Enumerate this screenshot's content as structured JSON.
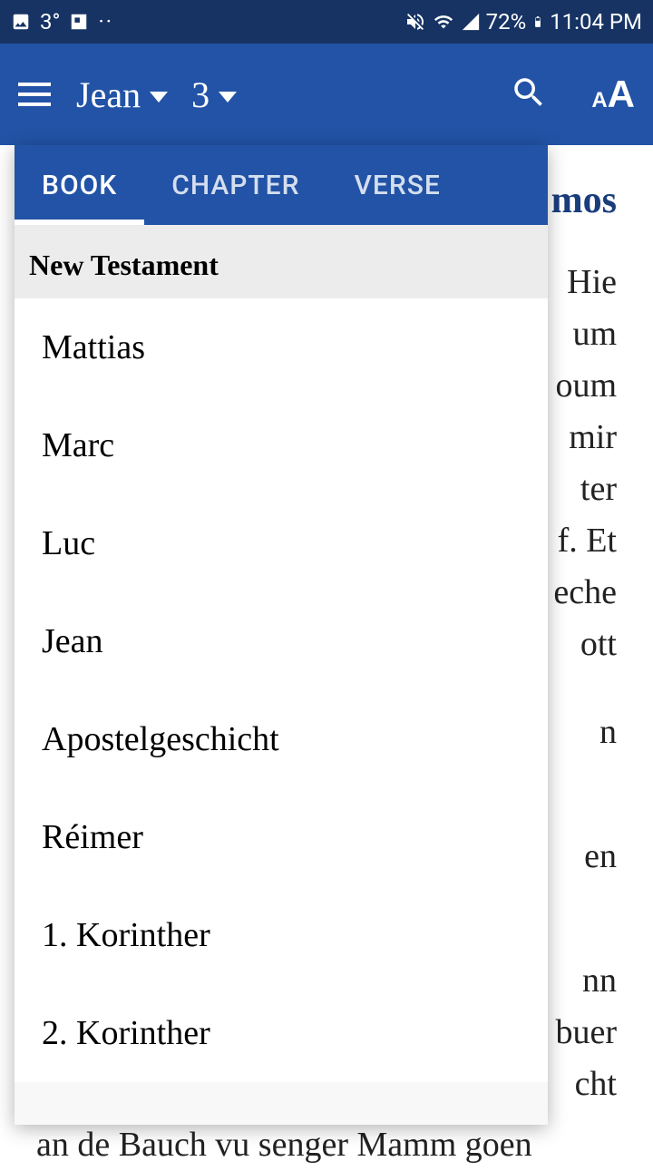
{
  "status_bar": {
    "temperature": "3°",
    "battery": "72%",
    "time": "11:04 PM"
  },
  "app_bar": {
    "book": "Jean",
    "chapter": "3"
  },
  "picker": {
    "tabs": {
      "book": "BOOK",
      "chapter": "CHAPTER",
      "verse": "VERSE"
    },
    "section_header": "New Testament",
    "books": [
      "Mattias",
      "Marc",
      "Luc",
      "Jean",
      "Apostelgeschicht",
      "Réimer",
      "1. Korinther",
      "2. Korinther"
    ]
  },
  "content": {
    "title_fragment": "mos",
    "lines": [
      "Hie",
      "um",
      "oum",
      "mir",
      "ter",
      "f. Et",
      "eche",
      "ott",
      "n",
      "en",
      "nn",
      "buer",
      "cht"
    ],
    "bottom_text": "an de Bauch vu senger Mamm goen"
  }
}
